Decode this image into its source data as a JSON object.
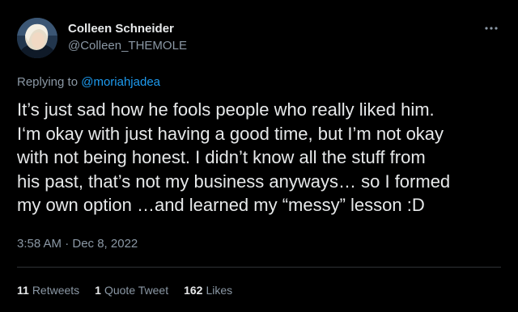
{
  "colors": {
    "background": "#000000",
    "primary_text": "#e7e9ea",
    "secondary_text": "#8b98a5",
    "link": "#1d9bf0",
    "divider": "#2f3336"
  },
  "author": {
    "display_name": "Colleen Schneider",
    "handle": "@Colleen_THEMOLE",
    "avatar_icon": "profile-photo"
  },
  "more_icon": "more-horizontal-icon",
  "reply": {
    "prefix": "Replying to ",
    "mention": "@moriahjadea"
  },
  "tweet": {
    "text": "It’s just sad how he fools people who really liked him.\nI‘m okay with just having a good time, but I’m not okay\nwith not being honest. I didn’t know all the stuff from\nhis past, that’s not my business anyways… so I formed\nmy own option …and learned my “messy” lesson :D",
    "timestamp": "3:58 AM · Dec 8, 2022"
  },
  "stats": {
    "retweets": {
      "count": "11",
      "label": "Retweets"
    },
    "quotes": {
      "count": "1",
      "label": "Quote Tweet"
    },
    "likes": {
      "count": "162",
      "label": "Likes"
    }
  }
}
